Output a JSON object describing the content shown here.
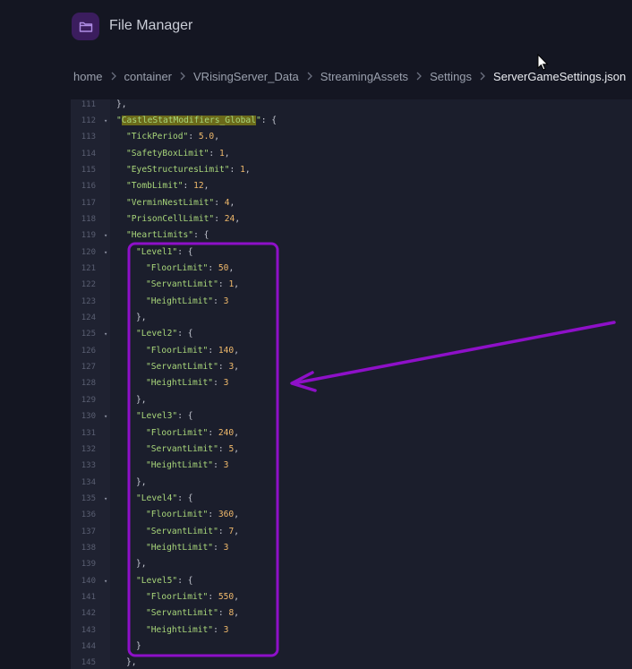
{
  "app": {
    "title": "File Manager",
    "icon": "folder-icon"
  },
  "breadcrumb": [
    "home",
    "container",
    "VRisingServer_Data",
    "StreamingAssets",
    "Settings",
    "ServerGameSettings.json"
  ],
  "editor": {
    "lines": [
      {
        "n": "111",
        "fold": false,
        "indent": 1,
        "parts": [
          {
            "t": "p",
            "v": "},"
          }
        ]
      },
      {
        "n": "112",
        "fold": true,
        "indent": 1,
        "parts": [
          {
            "t": "k",
            "v": "\""
          },
          {
            "t": "hl",
            "v": "CastleStatModifiers_Global"
          },
          {
            "t": "k",
            "v": "\""
          },
          {
            "t": "p",
            "v": ": {"
          }
        ]
      },
      {
        "n": "113",
        "fold": false,
        "indent": 2,
        "parts": [
          {
            "t": "k",
            "v": "\"TickPeriod\""
          },
          {
            "t": "p",
            "v": ": "
          },
          {
            "t": "n",
            "v": "5.0"
          },
          {
            "t": "p",
            "v": ","
          }
        ]
      },
      {
        "n": "114",
        "fold": false,
        "indent": 2,
        "parts": [
          {
            "t": "k",
            "v": "\"SafetyBoxLimit\""
          },
          {
            "t": "p",
            "v": ": "
          },
          {
            "t": "n",
            "v": "1"
          },
          {
            "t": "p",
            "v": ","
          }
        ]
      },
      {
        "n": "115",
        "fold": false,
        "indent": 2,
        "parts": [
          {
            "t": "k",
            "v": "\"EyeStructuresLimit\""
          },
          {
            "t": "p",
            "v": ": "
          },
          {
            "t": "n",
            "v": "1"
          },
          {
            "t": "p",
            "v": ","
          }
        ]
      },
      {
        "n": "116",
        "fold": false,
        "indent": 2,
        "parts": [
          {
            "t": "k",
            "v": "\"TombLimit\""
          },
          {
            "t": "p",
            "v": ": "
          },
          {
            "t": "n",
            "v": "12"
          },
          {
            "t": "p",
            "v": ","
          }
        ]
      },
      {
        "n": "117",
        "fold": false,
        "indent": 2,
        "parts": [
          {
            "t": "k",
            "v": "\"VerminNestLimit\""
          },
          {
            "t": "p",
            "v": ": "
          },
          {
            "t": "n",
            "v": "4"
          },
          {
            "t": "p",
            "v": ","
          }
        ]
      },
      {
        "n": "118",
        "fold": false,
        "indent": 2,
        "parts": [
          {
            "t": "k",
            "v": "\"PrisonCellLimit\""
          },
          {
            "t": "p",
            "v": ": "
          },
          {
            "t": "n",
            "v": "24"
          },
          {
            "t": "p",
            "v": ","
          }
        ]
      },
      {
        "n": "119",
        "fold": true,
        "indent": 2,
        "parts": [
          {
            "t": "k",
            "v": "\"HeartLimits\""
          },
          {
            "t": "p",
            "v": ": {"
          }
        ]
      },
      {
        "n": "120",
        "fold": true,
        "indent": 3,
        "parts": [
          {
            "t": "k",
            "v": "\"Level1\""
          },
          {
            "t": "p",
            "v": ": {"
          }
        ]
      },
      {
        "n": "121",
        "fold": false,
        "indent": 4,
        "parts": [
          {
            "t": "k",
            "v": "\"FloorLimit\""
          },
          {
            "t": "p",
            "v": ": "
          },
          {
            "t": "n",
            "v": "50"
          },
          {
            "t": "p",
            "v": ","
          }
        ]
      },
      {
        "n": "122",
        "fold": false,
        "indent": 4,
        "parts": [
          {
            "t": "k",
            "v": "\"ServantLimit\""
          },
          {
            "t": "p",
            "v": ": "
          },
          {
            "t": "n",
            "v": "1"
          },
          {
            "t": "p",
            "v": ","
          }
        ]
      },
      {
        "n": "123",
        "fold": false,
        "indent": 4,
        "parts": [
          {
            "t": "k",
            "v": "\"HeightLimit\""
          },
          {
            "t": "p",
            "v": ": "
          },
          {
            "t": "n",
            "v": "3"
          }
        ]
      },
      {
        "n": "124",
        "fold": false,
        "indent": 3,
        "parts": [
          {
            "t": "p",
            "v": "},"
          }
        ]
      },
      {
        "n": "125",
        "fold": true,
        "indent": 3,
        "parts": [
          {
            "t": "k",
            "v": "\"Level2\""
          },
          {
            "t": "p",
            "v": ": {"
          }
        ]
      },
      {
        "n": "126",
        "fold": false,
        "indent": 4,
        "parts": [
          {
            "t": "k",
            "v": "\"FloorLimit\""
          },
          {
            "t": "p",
            "v": ": "
          },
          {
            "t": "n",
            "v": "140"
          },
          {
            "t": "p",
            "v": ","
          }
        ]
      },
      {
        "n": "127",
        "fold": false,
        "indent": 4,
        "parts": [
          {
            "t": "k",
            "v": "\"ServantLimit\""
          },
          {
            "t": "p",
            "v": ": "
          },
          {
            "t": "n",
            "v": "3"
          },
          {
            "t": "p",
            "v": ","
          }
        ]
      },
      {
        "n": "128",
        "fold": false,
        "indent": 4,
        "parts": [
          {
            "t": "k",
            "v": "\"HeightLimit\""
          },
          {
            "t": "p",
            "v": ": "
          },
          {
            "t": "n",
            "v": "3"
          }
        ]
      },
      {
        "n": "129",
        "fold": false,
        "indent": 3,
        "parts": [
          {
            "t": "p",
            "v": "},"
          }
        ]
      },
      {
        "n": "130",
        "fold": true,
        "indent": 3,
        "parts": [
          {
            "t": "k",
            "v": "\"Level3\""
          },
          {
            "t": "p",
            "v": ": {"
          }
        ]
      },
      {
        "n": "131",
        "fold": false,
        "indent": 4,
        "parts": [
          {
            "t": "k",
            "v": "\"FloorLimit\""
          },
          {
            "t": "p",
            "v": ": "
          },
          {
            "t": "n",
            "v": "240"
          },
          {
            "t": "p",
            "v": ","
          }
        ]
      },
      {
        "n": "132",
        "fold": false,
        "indent": 4,
        "parts": [
          {
            "t": "k",
            "v": "\"ServantLimit\""
          },
          {
            "t": "p",
            "v": ": "
          },
          {
            "t": "n",
            "v": "5"
          },
          {
            "t": "p",
            "v": ","
          }
        ]
      },
      {
        "n": "133",
        "fold": false,
        "indent": 4,
        "parts": [
          {
            "t": "k",
            "v": "\"HeightLimit\""
          },
          {
            "t": "p",
            "v": ": "
          },
          {
            "t": "n",
            "v": "3"
          }
        ]
      },
      {
        "n": "134",
        "fold": false,
        "indent": 3,
        "parts": [
          {
            "t": "p",
            "v": "},"
          }
        ]
      },
      {
        "n": "135",
        "fold": true,
        "indent": 3,
        "parts": [
          {
            "t": "k",
            "v": "\"Level4\""
          },
          {
            "t": "p",
            "v": ": {"
          }
        ]
      },
      {
        "n": "136",
        "fold": false,
        "indent": 4,
        "parts": [
          {
            "t": "k",
            "v": "\"FloorLimit\""
          },
          {
            "t": "p",
            "v": ": "
          },
          {
            "t": "n",
            "v": "360"
          },
          {
            "t": "p",
            "v": ","
          }
        ]
      },
      {
        "n": "137",
        "fold": false,
        "indent": 4,
        "parts": [
          {
            "t": "k",
            "v": "\"ServantLimit\""
          },
          {
            "t": "p",
            "v": ": "
          },
          {
            "t": "n",
            "v": "7"
          },
          {
            "t": "p",
            "v": ","
          }
        ]
      },
      {
        "n": "138",
        "fold": false,
        "indent": 4,
        "parts": [
          {
            "t": "k",
            "v": "\"HeightLimit\""
          },
          {
            "t": "p",
            "v": ": "
          },
          {
            "t": "n",
            "v": "3"
          }
        ]
      },
      {
        "n": "139",
        "fold": false,
        "indent": 3,
        "parts": [
          {
            "t": "p",
            "v": "},"
          }
        ]
      },
      {
        "n": "140",
        "fold": true,
        "indent": 3,
        "parts": [
          {
            "t": "k",
            "v": "\"Level5\""
          },
          {
            "t": "p",
            "v": ": {"
          }
        ]
      },
      {
        "n": "141",
        "fold": false,
        "indent": 4,
        "parts": [
          {
            "t": "k",
            "v": "\"FloorLimit\""
          },
          {
            "t": "p",
            "v": ": "
          },
          {
            "t": "n",
            "v": "550"
          },
          {
            "t": "p",
            "v": ","
          }
        ]
      },
      {
        "n": "142",
        "fold": false,
        "indent": 4,
        "parts": [
          {
            "t": "k",
            "v": "\"ServantLimit\""
          },
          {
            "t": "p",
            "v": ": "
          },
          {
            "t": "n",
            "v": "8"
          },
          {
            "t": "p",
            "v": ","
          }
        ]
      },
      {
        "n": "143",
        "fold": false,
        "indent": 4,
        "parts": [
          {
            "t": "k",
            "v": "\"HeightLimit\""
          },
          {
            "t": "p",
            "v": ": "
          },
          {
            "t": "n",
            "v": "3"
          }
        ]
      },
      {
        "n": "144",
        "fold": false,
        "indent": 3,
        "parts": [
          {
            "t": "p",
            "v": "}"
          }
        ]
      },
      {
        "n": "145",
        "fold": false,
        "indent": 2,
        "parts": [
          {
            "t": "p",
            "v": "},"
          }
        ]
      }
    ]
  },
  "annotation": {
    "color": "#8e10c8"
  }
}
